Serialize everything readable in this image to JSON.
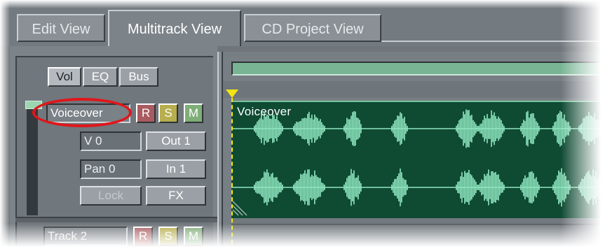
{
  "tabs": [
    {
      "label": "Edit View",
      "active": false
    },
    {
      "label": "Multitrack View",
      "active": true
    },
    {
      "label": "CD Project View",
      "active": false
    }
  ],
  "mixer_tabs": {
    "vol": "Vol",
    "eq": "EQ",
    "bus": "Bus",
    "selected": "Vol"
  },
  "track1": {
    "name": "Voiceover",
    "record": "R",
    "solo": "S",
    "mute": "M",
    "volume": "V 0",
    "output": "Out 1",
    "pan": "Pan 0",
    "input": "In 1",
    "lock": "Lock",
    "fx": "FX"
  },
  "track2": {
    "name": "Track 2",
    "record": "R",
    "solo": "S",
    "mute": "M"
  },
  "clip": {
    "label": "Voiceover"
  },
  "colors": {
    "clip_background": "#0f4a33",
    "waveform": "#8fe7c0",
    "highlight": "#e0161a",
    "playhead": "#f2e414",
    "record_button": "#a95b60",
    "solo_button": "#b7ae4d",
    "mute_button": "#7fae78"
  }
}
